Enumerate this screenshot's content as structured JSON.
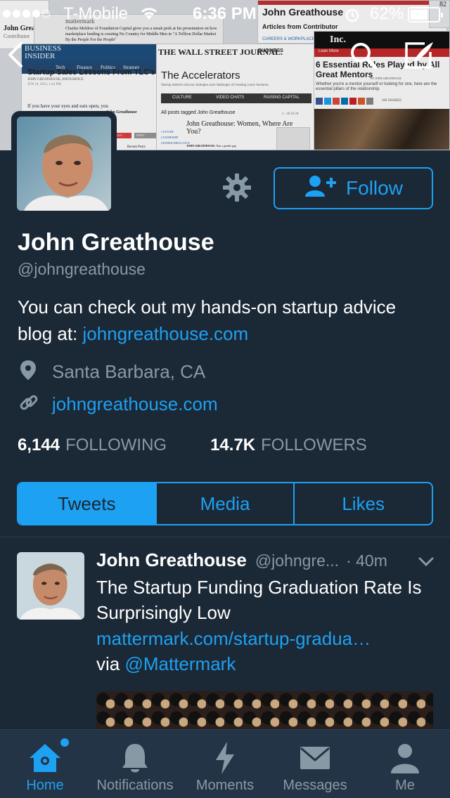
{
  "status_bar": {
    "carrier": "T-Mobile",
    "time": "6:36 PM",
    "battery": "62%",
    "battery_level": 0.62,
    "signal_bars_filled": 4,
    "signal_bars_total": 5
  },
  "header_images": {
    "clips": [
      {
        "text_1": "John Greathouse",
        "text_2": "Contributor"
      },
      {
        "text_1": "mattermark",
        "text_2": "Charles Moldow of Foundation Capital gives you a sneak peek at his presentation on how marketplace lending is creating No Country for Middle Men in \"A Trillion Dollar Market By the People For the People\""
      },
      {
        "brand": "BUSINESS INSIDER",
        "nav": [
          "Tech",
          "Finance",
          "Politics",
          "Strategy"
        ],
        "headline": "Startup Sales Lessons From TLC's Say Yes To Th",
        "byline": "JOHN GREATHOUSE, INFOCHOICE",
        "date": "JUN 18, 2013, 1:42 PM",
        "share_buttons": [
          "FACEBOOK",
          "LINKEDIN",
          "TWITTER",
          "GOOGLE+",
          "PRINT"
        ],
        "body": "If you have your eyes and ears open, you",
        "sidebar_name": "John Greathouse",
        "sidebar_heading": "Recent Posts"
      },
      {
        "brand": "THE WALL STREET JOURNAL.",
        "section": "BUSINESS",
        "title": "The Accelerators",
        "subtitle": "Startup mentors discuss strategies and challenges of creating a new business.",
        "nav": [
          "CULTURE",
          "VIDEO CHATS",
          "RAISING CAPITAL"
        ],
        "tagged": "All posts tagged John Greathouse",
        "pagination": "1 - 10 of 24",
        "article_title": "John Greathouse: Women, Where Are You?",
        "byline": "JOHN GREATHOUSE:",
        "snippet": "That a gender gap",
        "tags": [
          "CULTURE",
          "LEADERSHIP",
          "GENDER IMBALANCE"
        ]
      },
      {
        "byline": "John Greathouse",
        "section": "Articles from Contributor",
        "category": "CAREERS & WORKPLACE"
      },
      {
        "brand": "Inc.",
        "headline": "6 Essential Roles Played by All Great Mentors",
        "byline": "BY JOHN GREATHOUSE",
        "body": "Whether you're a mentor yourself or looking for one, here are the essential pillars of the relationship.",
        "label": "Lean More",
        "shares": "300 SHARES"
      },
      {
        "text_1": "82"
      }
    ]
  },
  "nav": {
    "back_icon": "chevron-left-icon",
    "search_icon": "search-icon",
    "compose_icon": "compose-icon"
  },
  "profile": {
    "name": "John Greathouse",
    "handle": "@johngreathouse",
    "bio_text": "You can check out my hands-on startup advice blog at: ",
    "bio_link": "johngreathouse.com",
    "location": "Santa Barbara, CA",
    "website": "johngreathouse.com",
    "following_count": "6,144",
    "following_label": "FOLLOWING",
    "followers_count": "14.7K",
    "followers_label": "FOLLOWERS",
    "follow_button": "Follow"
  },
  "tabs": [
    {
      "label": "Tweets",
      "selected": true
    },
    {
      "label": "Media",
      "selected": false
    },
    {
      "label": "Likes",
      "selected": false
    }
  ],
  "tweet": {
    "name": "John Greathouse",
    "handle": "@johngre...",
    "time": "· 40m",
    "text": "The Startup Funding Graduation Rate Is Surprisingly Low",
    "link": "mattermark.com/startup-gradua…",
    "via": "via ",
    "mention": "@Mattermark"
  },
  "tabbar": [
    {
      "label": "Home",
      "icon": "home-icon",
      "active": true,
      "badge": true
    },
    {
      "label": "Notifications",
      "icon": "bell-icon",
      "active": false,
      "badge": false
    },
    {
      "label": "Moments",
      "icon": "lightning-icon",
      "active": false,
      "badge": false
    },
    {
      "label": "Messages",
      "icon": "envelope-icon",
      "active": false,
      "badge": false
    },
    {
      "label": "Me",
      "icon": "person-icon",
      "active": false,
      "badge": false
    }
  ],
  "colors": {
    "background": "#1b2836",
    "accent": "#1da1f2",
    "secondary_text": "#8899a6",
    "tabbar_bg": "#243447"
  }
}
